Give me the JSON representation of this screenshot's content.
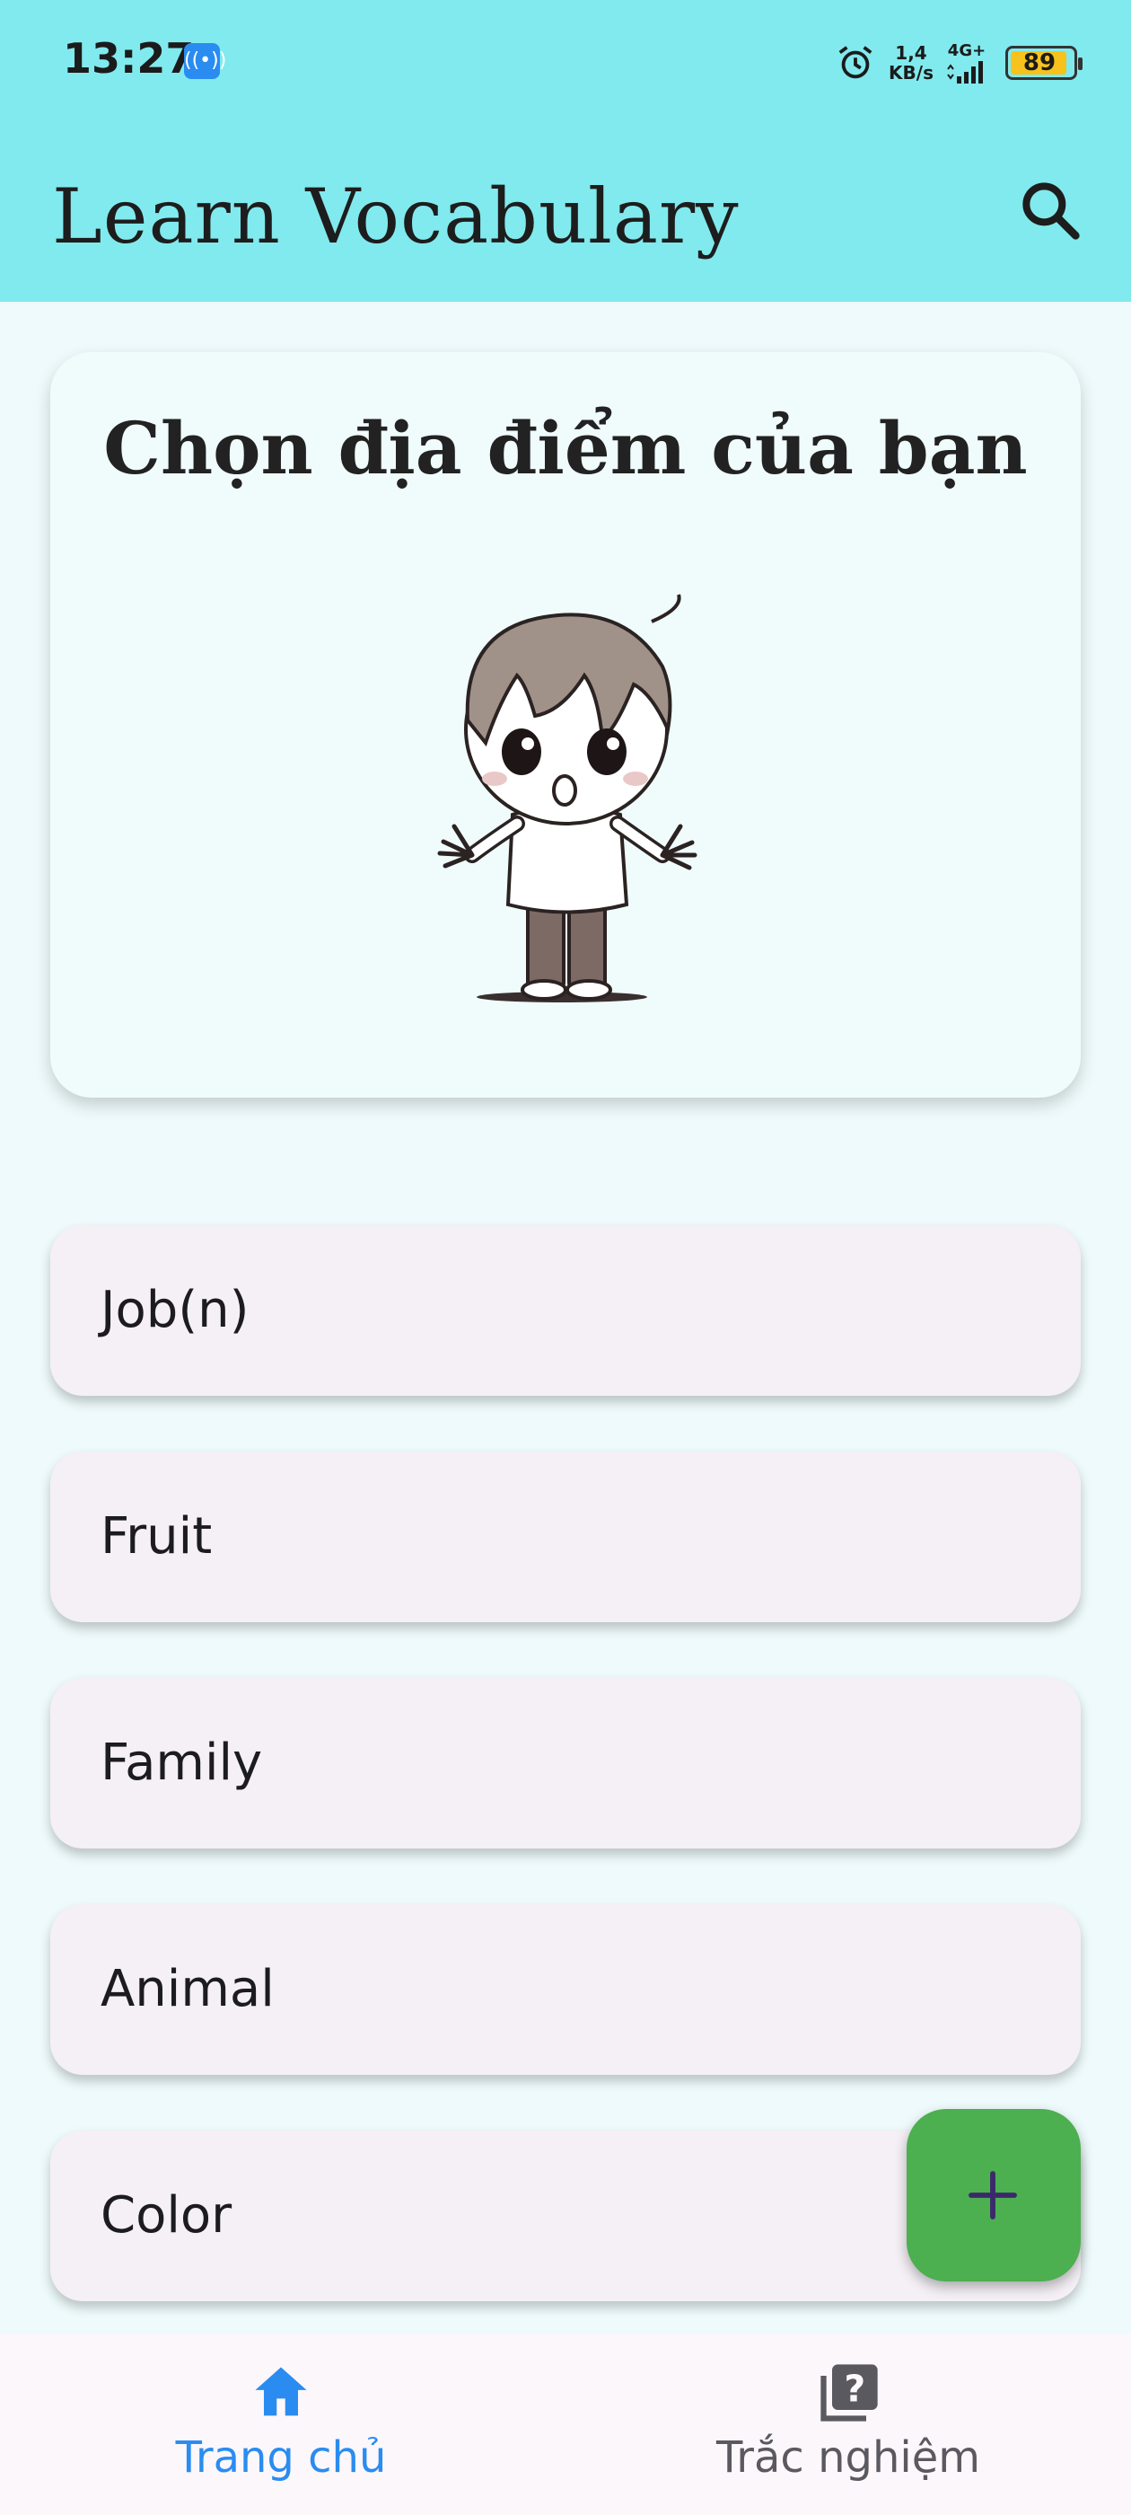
{
  "status_bar": {
    "time": "13:27",
    "hotspot_icon": "hotspot-icon",
    "alarm_icon": "alarm-icon",
    "speed_value": "1,4",
    "speed_unit": "KB/s",
    "network_type": "4G+",
    "battery_percent": "89",
    "battery_color": "#f7c21c"
  },
  "app_bar": {
    "title": "Learn Vocabulary",
    "search_icon": "search-icon",
    "background": "#81eaee"
  },
  "hero": {
    "title": "Chọn địa điểm của bạn",
    "image": "confused-boy-illustration"
  },
  "topics": [
    {
      "label": "Job(n)"
    },
    {
      "label": "Fruit"
    },
    {
      "label": "Family"
    },
    {
      "label": "Animal"
    },
    {
      "label": "Color"
    }
  ],
  "fab": {
    "icon": "add-icon",
    "color": "#4caf50"
  },
  "bottom_nav": {
    "items": [
      {
        "label": "Trang chủ",
        "icon": "home-icon",
        "active": true,
        "color": "#2a8cf0"
      },
      {
        "label": "Trắc nghiệm",
        "icon": "quiz-icon",
        "active": false,
        "color": "#5b5960"
      }
    ]
  }
}
